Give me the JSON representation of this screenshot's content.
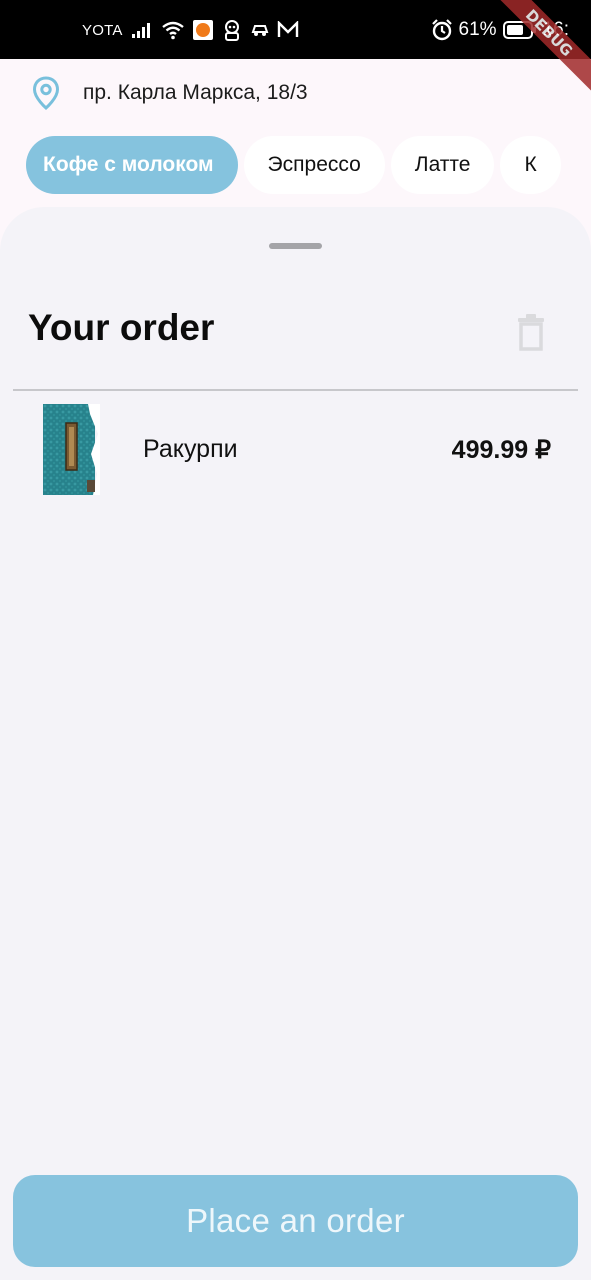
{
  "status_bar": {
    "carrier": "YOTA",
    "battery": "61%",
    "time": "16:",
    "debug_banner": "DEBUG"
  },
  "location": {
    "icon": "location-pin-icon",
    "address": "пр. Карла Маркса, 18/3"
  },
  "categories": [
    {
      "label": "Кофе с молоком",
      "active": true
    },
    {
      "label": "Эспрессо",
      "active": false
    },
    {
      "label": "Латте",
      "active": false
    },
    {
      "label": "К",
      "active": false
    }
  ],
  "order": {
    "title": "Your order",
    "clear_icon": "trash-icon",
    "items": [
      {
        "name": "Ракурпи",
        "price": "499.99 ₽"
      }
    ],
    "submit_label": "Place an order"
  },
  "colors": {
    "accent": "#85c3de",
    "pin": "#79c0dc",
    "sheet_bg": "#f4f3f8",
    "page_bg": "#fdf7fb"
  }
}
